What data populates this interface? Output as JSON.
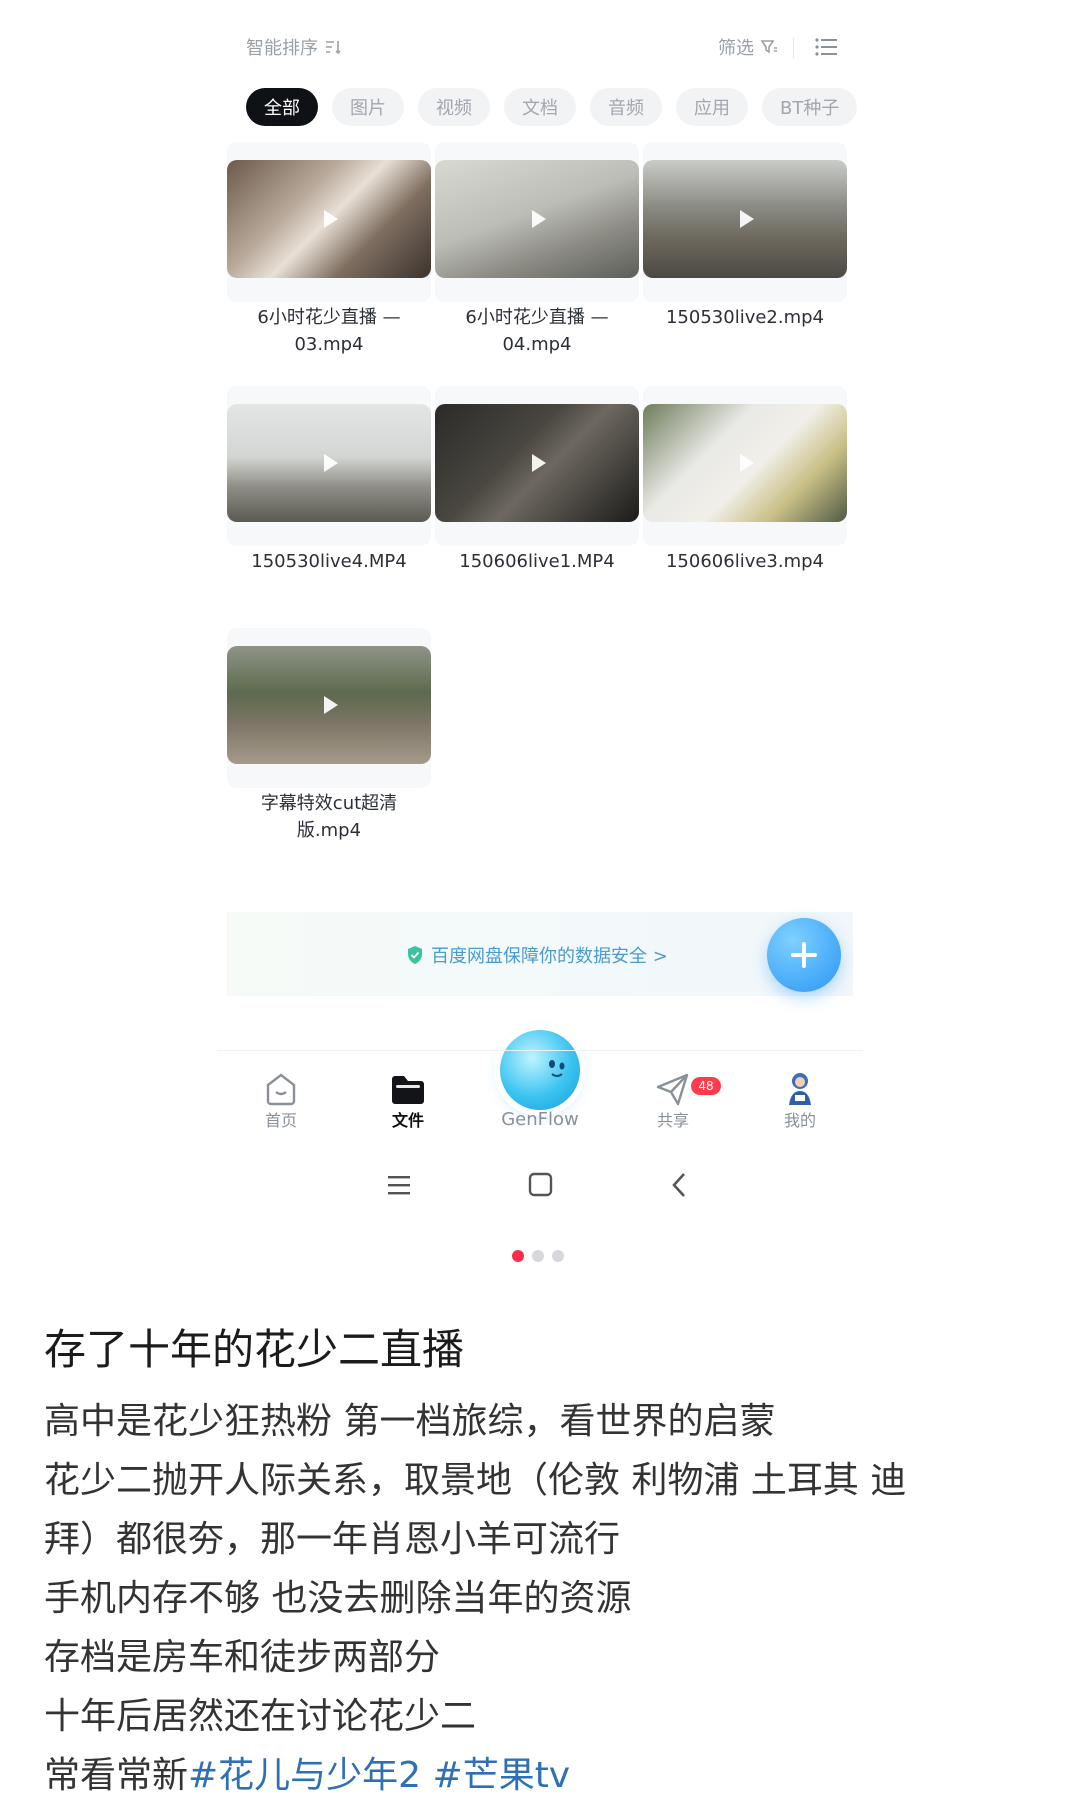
{
  "toolbar": {
    "sort_label": "智能排序",
    "filter_label": "筛选"
  },
  "chips": [
    "全部",
    "图片",
    "视频",
    "文档",
    "音频",
    "应用",
    "BT种子"
  ],
  "videos": [
    {
      "name": "6小时花少直播 —\n03.mp4"
    },
    {
      "name": "6小时花少直播 —\n04.mp4"
    },
    {
      "name": "150530live2.mp4"
    },
    {
      "name": "150530live4.MP4"
    },
    {
      "name": "150606live1.MP4"
    },
    {
      "name": "150606live3.mp4"
    },
    {
      "name": "字幕特效cut超清\n版.mp4"
    }
  ],
  "banner": {
    "text": "百度网盘保障你的数据安全 >"
  },
  "nav": {
    "home": "首页",
    "files": "文件",
    "genflow": "GenFlow",
    "share": "共享",
    "share_badge": "48",
    "me": "我的"
  },
  "post": {
    "title": "存了十年的花少二直播",
    "lines": [
      "高中是花少狂热粉 第一档旅综，看世界的启蒙",
      "花少二抛开人际关系，取景地（伦敦 利物浦 土耳其 迪",
      "拜）都很夯，那一年肖恩小羊可流行",
      "手机内存不够 也没去删除当年的资源",
      "存档是房车和徒步两部分",
      "十年后居然还在讨论花少二"
    ],
    "last_line_prefix": "常看常新",
    "hashtags": "#花儿与少年2 #芒果tv"
  },
  "colors": {
    "accent_blue": "#2b95f5",
    "badge_red": "#ff3b4c",
    "active_chip": "#0e1116"
  }
}
